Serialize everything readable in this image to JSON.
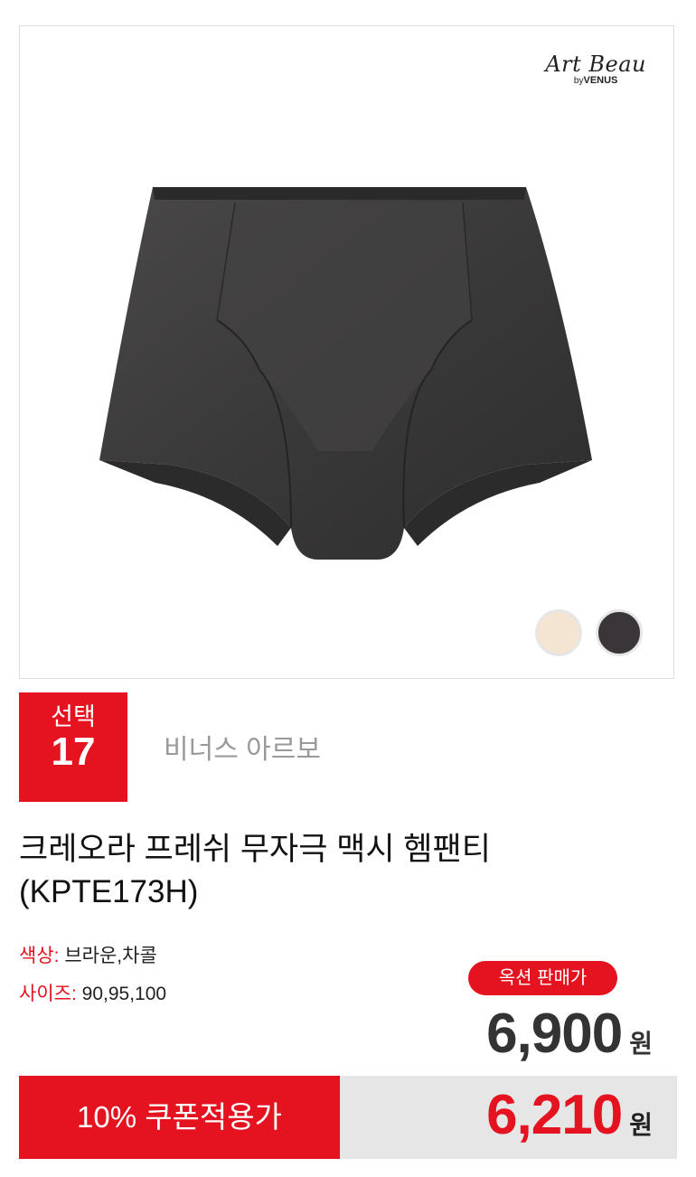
{
  "brand_logo": {
    "script": "Art Beau",
    "by": "by",
    "maker": "VENUS"
  },
  "swatches": [
    {
      "name": "beige",
      "color": "#f4e4d2"
    },
    {
      "name": "charcoal",
      "color": "#3a3539"
    }
  ],
  "badge": {
    "label": "선택",
    "number": "17"
  },
  "brand_name": "비너스 아르보",
  "title": {
    "line1": "크레오라 프레쉬 무자극 맥시 헴팬티",
    "line2": "(KPTE173H)"
  },
  "specs": {
    "color_key": "색상:",
    "color_value": "브라운,차콜",
    "size_key": "사이즈:",
    "size_value": "90,95,100"
  },
  "auction": {
    "label": "옥션 판매가",
    "price": "6,900",
    "unit": "원"
  },
  "coupon": {
    "label": "10% 쿠폰적용가",
    "price": "6,210",
    "unit": "원"
  },
  "colors": {
    "accent": "#e5121f",
    "fabric": "#3b3a3a"
  }
}
